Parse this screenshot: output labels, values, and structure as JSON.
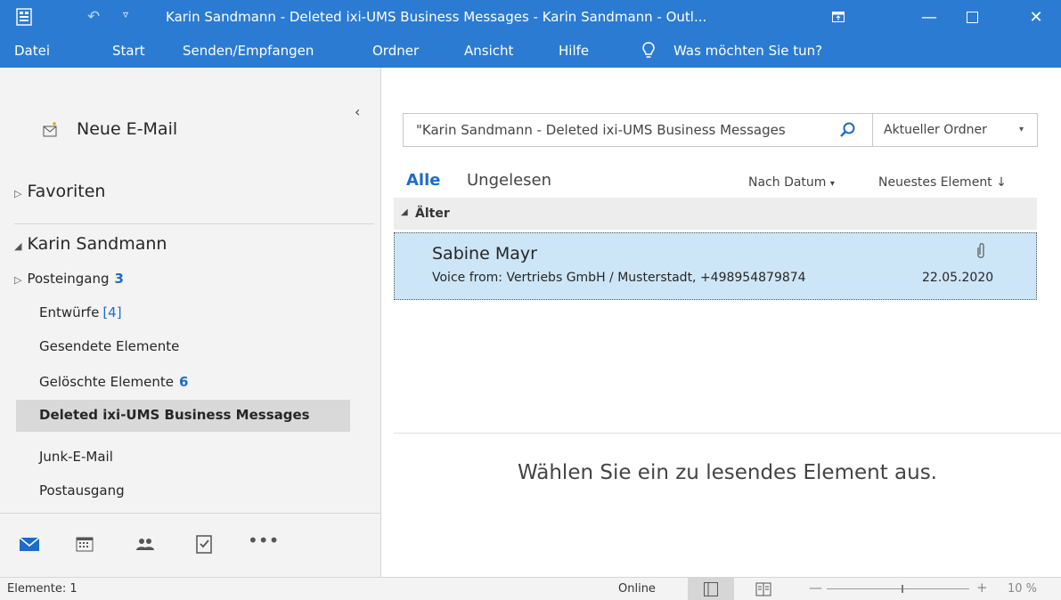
{
  "window": {
    "title": "Karin Sandmann - Deleted ixi-UMS Business Messages - Karin Sandmann  -  Outl...",
    "accent_color": "#2b7bd3"
  },
  "menu": {
    "items": [
      "Datei",
      "Start",
      "Senden/Empfangen",
      "Ordner",
      "Ansicht",
      "Hilfe"
    ],
    "tell_me": "Was möchten Sie tun?"
  },
  "nav": {
    "new_mail": "Neue E-Mail",
    "favorites": "Favoriten",
    "account": "Karin Sandmann",
    "folders": [
      {
        "label": "Posteingang",
        "count": "3"
      },
      {
        "label": "Entwürfe",
        "count": "[4]"
      },
      {
        "label": "Gesendete Elemente",
        "count": ""
      },
      {
        "label": "Gelöschte Elemente",
        "count": "6"
      },
      {
        "label": "Deleted ixi-UMS Business Messages",
        "count": ""
      },
      {
        "label": "Junk-E-Mail",
        "count": ""
      },
      {
        "label": "Postausgang",
        "count": ""
      }
    ],
    "selected_folder": "Deleted ixi-UMS Business Messages"
  },
  "search": {
    "value": "\"Karin Sandmann - Deleted ixi-UMS Business Messages",
    "scope": "Aktueller Ordner"
  },
  "list": {
    "filter_all": "Alle",
    "filter_unread": "Ungelesen",
    "sort_by": "Nach Datum",
    "sort_order": "Neuestes Element",
    "group": "Älter",
    "items": [
      {
        "sender": "Sabine Mayr",
        "subject": "Voice from: Vertriebs GmbH / Musterstadt, +498954879874",
        "date": "22.05.2020"
      }
    ]
  },
  "reading_pane": {
    "empty_text": "Wählen Sie ein zu lesendes Element aus."
  },
  "status": {
    "items": "Elemente: 1",
    "connection": "Online",
    "zoom": "10 %"
  }
}
